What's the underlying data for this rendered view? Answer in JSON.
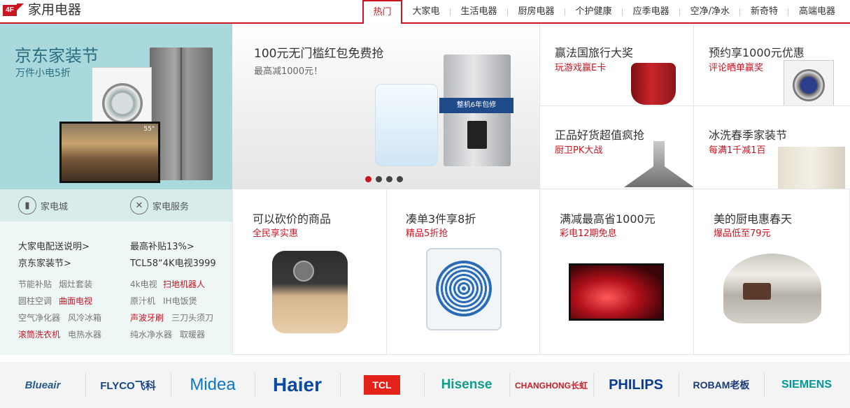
{
  "header": {
    "floor": "4F",
    "title": "家用电器",
    "tabs": [
      "热门",
      "大家电",
      "生活电器",
      "厨房电器",
      "个护健康",
      "应季电器",
      "空净/净水",
      "新奇特",
      "高端电器"
    ]
  },
  "left": {
    "title": "京东家装节",
    "subtitle": "万件小电5折",
    "tv_size": "55\"",
    "services": [
      "家电城",
      "家电服务"
    ],
    "links": [
      "大家电配送说明>",
      "最高补贴13%>",
      "京东家装节>",
      "TCL58“4K电视3999"
    ],
    "small": [
      [
        "节能补贴",
        "烟灶套装"
      ],
      [
        "4k电视",
        "扫地机器人"
      ],
      [
        "圆柱空调",
        "曲面电视"
      ],
      [
        "原汁机",
        "IH电饭煲"
      ],
      [
        "空气净化器",
        "风冷冰箱"
      ],
      [
        "声波牙刷",
        "三刀头须刀"
      ],
      [
        "滚筒洗衣机",
        "电热水器"
      ],
      [
        "纯水净水器",
        "取暖器"
      ]
    ]
  },
  "carousel": {
    "title": "100元无门槛红包免费抢",
    "subtitle": "最高减1000元！",
    "badge": "整机6年包修",
    "badge_num": "6"
  },
  "promos": [
    {
      "title": "赢法国旅行大奖",
      "sub": "玩游戏赢E卡"
    },
    {
      "title": "预约享1000元优惠",
      "sub": "评论晒单赢奖"
    },
    {
      "title": "正品好货超值疯抢",
      "sub": "厨卫PK大战"
    },
    {
      "title": "冰洗春季家装节",
      "sub": "每满1千减1百"
    },
    {
      "title": "可以砍价的商品",
      "sub": "全民享实惠"
    },
    {
      "title": "凑单3件享8折",
      "sub": "精品5折抢"
    },
    {
      "title": "满减最高省1000元",
      "sub": "彩电12期免息"
    },
    {
      "title": "美的厨电惠春天",
      "sub": "爆品低至79元"
    }
  ],
  "brands": [
    "Blueair",
    "FLYCO飞科",
    "Midea",
    "Haier",
    "TCL",
    "Hisense",
    "CHANGHONG长虹",
    "PHILIPS",
    "ROBAM老板",
    "SIEMENS"
  ],
  "colors": {
    "accent": "#c81623",
    "teal": "#a9d9dc"
  }
}
